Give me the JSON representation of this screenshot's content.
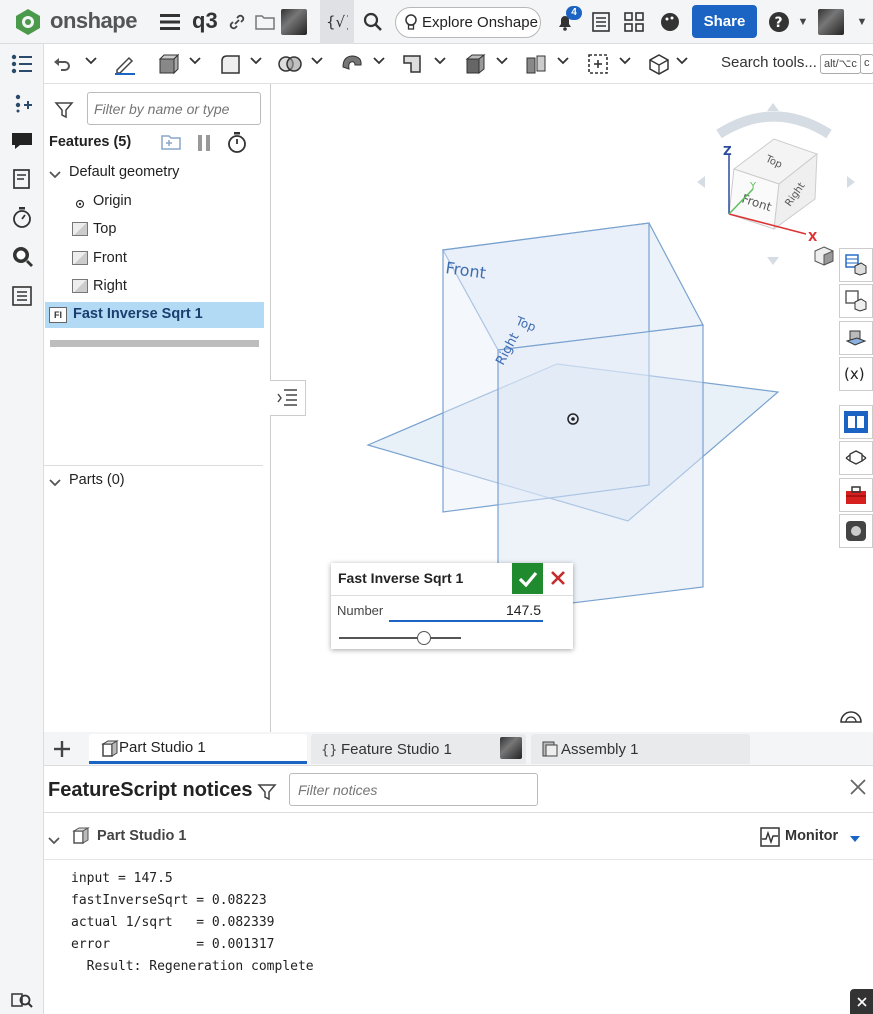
{
  "app": {
    "brand": "onshape",
    "document_title": "q3",
    "explore_label": "Explore Onshape",
    "notification_count": "4",
    "share_label": "Share"
  },
  "toolbar": {
    "search_label": "Search tools...",
    "shortcut_1": "alt/⌥c",
    "shortcut_2": "c"
  },
  "features": {
    "filter_placeholder": "Filter by name or type",
    "header": "Features (5)",
    "default_geometry": "Default geometry",
    "items": [
      {
        "label": "Origin"
      },
      {
        "label": "Top"
      },
      {
        "label": "Front"
      },
      {
        "label": "Right"
      }
    ],
    "feature_badge": "FI",
    "selected_feature": "Fast Inverse Sqrt 1",
    "parts_header": "Parts (0)"
  },
  "viewport": {
    "plane_labels": {
      "front": "Front",
      "top": "Top",
      "right": "Right"
    },
    "view_cube": {
      "top": "Top",
      "front": "Front",
      "right": "Right",
      "axis_x": "X",
      "axis_y": "Y",
      "axis_z": "Z"
    }
  },
  "dialog": {
    "title": "Fast Inverse Sqrt 1",
    "number_label": "Number",
    "number_value": "147.5",
    "slider_fraction": 0.7
  },
  "tabs": [
    {
      "label": "Part Studio 1"
    },
    {
      "label": "Feature Studio 1"
    },
    {
      "label": "Assembly 1"
    }
  ],
  "notices": {
    "title": "FeatureScript notices",
    "filter_placeholder": "Filter notices",
    "studio_name": "Part Studio 1",
    "monitor_label": "Monitor",
    "log": [
      "input = 147.5",
      "fastInverseSqrt = 0.08223",
      "actual 1/sqrt   = 0.082339",
      "error           = 0.001317",
      "  Result: Regeneration complete"
    ]
  },
  "colors": {
    "accent": "#1b64c4",
    "selected_row": "#b3daf5",
    "plane_fill": "#dbe7f4",
    "plane_stroke": "#6f9ccf",
    "ok_green": "#1f8a2e",
    "cancel_red": "#c42b2b"
  }
}
